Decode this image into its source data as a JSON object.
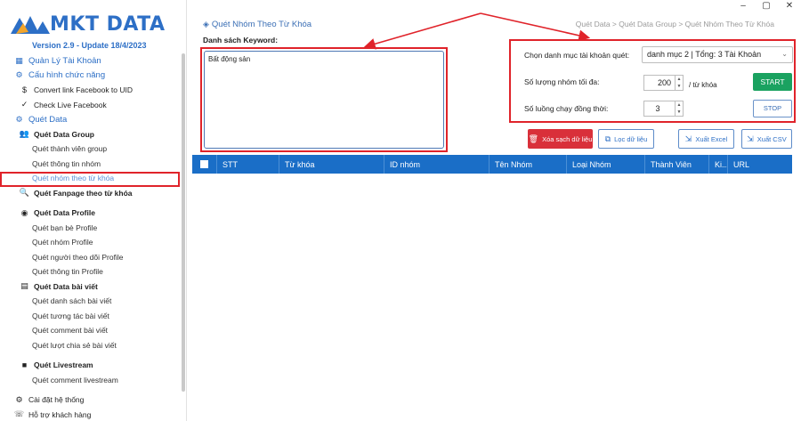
{
  "window_controls": {
    "minimize": "–",
    "maximize": "▢",
    "close": "✕"
  },
  "sidebar": {
    "logo_text": "MKT DATA",
    "version": "Version 2.9 - Update 18/4/2023",
    "items": [
      {
        "label": "Quản Lý Tài Khoản",
        "icon": "account-icon",
        "glyph": "▦"
      },
      {
        "label": "Cấu hình chức năng",
        "icon": "config-icon",
        "glyph": "⚙"
      },
      {
        "label": "Convert link Facebook to UID",
        "icon": "dollar-icon",
        "glyph": "$"
      },
      {
        "label": "Check Live Facebook",
        "icon": "check-circle-icon",
        "glyph": "✓"
      },
      {
        "label": "Quét Data",
        "icon": "gear-icon",
        "glyph": "⚙"
      },
      {
        "label": "Quét Data Group",
        "icon": "group-icon",
        "glyph": "👥"
      },
      {
        "label": "Quét thành viên group"
      },
      {
        "label": "Quét thông tin nhóm"
      },
      {
        "label": "Quét nhóm theo từ khóa"
      },
      {
        "label": "Quét Fanpage theo từ khóa",
        "icon": "search-icon",
        "glyph": "🔍"
      },
      {
        "label": "Quét Data Profile",
        "icon": "profile-icon",
        "glyph": "◉"
      },
      {
        "label": "Quét bạn bè Profile"
      },
      {
        "label": "Quét nhóm Profile"
      },
      {
        "label": "Quét người theo dõi Profile"
      },
      {
        "label": "Quét thông tin Profile"
      },
      {
        "label": "Quét Data bài viết",
        "icon": "post-icon",
        "glyph": "▤"
      },
      {
        "label": "Quét danh sách bài viết"
      },
      {
        "label": "Quét tương tác bài viết"
      },
      {
        "label": "Quét comment bài viết"
      },
      {
        "label": "Quét lượt chia sẻ bài viết"
      },
      {
        "label": "Quét Livestream",
        "icon": "video-icon",
        "glyph": "■"
      },
      {
        "label": "Quét comment livestream"
      },
      {
        "label": "Cài đặt hệ thống",
        "icon": "settings-icon",
        "glyph": "⚙"
      },
      {
        "label": "Hỗ trợ khách hàng",
        "icon": "support-icon",
        "glyph": "☏"
      }
    ]
  },
  "main": {
    "page_title": "Quét Nhóm Theo Từ Khóa",
    "breadcrumb": "Quét Data > Quét Data Group > Quét Nhóm Theo Từ Khóa",
    "keyword_label": "Danh sách Keyword:",
    "keyword_value": "Bất động sản",
    "config": {
      "account_label": "Chọn danh mục tài khoản quét:",
      "account_value": "danh mục 2 | Tổng: 3 Tài Khoản",
      "max_groups_label": "Số lượng nhóm tối đa:",
      "max_groups_value": "200",
      "max_groups_unit": "/ từ khóa",
      "threads_label": "Số luồng chạy đồng thời:",
      "threads_value": "3",
      "start_label": "START",
      "stop_label": "STOP"
    },
    "actions": {
      "clear_label": "Xóa sạch dữ liệu",
      "filter_label": "Lọc dữ liệu",
      "excel_label": "Xuất Excel",
      "csv_label": "Xuất CSV"
    },
    "table": {
      "columns": [
        "STT",
        "Từ khóa",
        "ID nhóm",
        "Tên Nhóm",
        "Loại Nhóm",
        "Thành Viên",
        "Ki...",
        "URL"
      ]
    }
  },
  "colors": {
    "accent": "#2d6fc6",
    "table_header": "#1a6ec7",
    "start": "#1aa260",
    "danger": "#d9303a",
    "annotation": "#e0232a"
  }
}
